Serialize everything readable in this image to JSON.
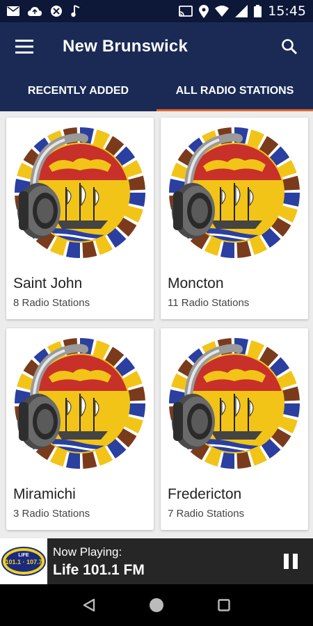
{
  "status_bar": {
    "time": "15:45",
    "icons": [
      "mail-icon",
      "cloud-upload-icon",
      "vpn-icon",
      "music-icon",
      "cast-icon",
      "location-icon",
      "wifi-icon",
      "signal-icon",
      "battery-icon"
    ]
  },
  "app_bar": {
    "title": "New Brunswick",
    "menu_icon": "menu-icon",
    "search_icon": "search-icon"
  },
  "tabs": [
    {
      "label": "RECENTLY ADDED",
      "active": false
    },
    {
      "label": "ALL RADIO STATIONS",
      "active": true
    }
  ],
  "cities": [
    {
      "name": "Saint John",
      "count": "8 Radio Stations"
    },
    {
      "name": "Moncton",
      "count": "11 Radio Stations"
    },
    {
      "name": "Miramichi",
      "count": "3 Radio Stations"
    },
    {
      "name": "Fredericton",
      "count": "7 Radio Stations"
    }
  ],
  "player": {
    "label": "Now Playing:",
    "station": "Life 101.1 FM",
    "logo_text": "101.1 · 107.7",
    "logo_top": "LIFE"
  },
  "colors": {
    "status_bar": "#0d1738",
    "app_bar": "#1a2a55",
    "tab_indicator": "#e0642c",
    "player_bg": "#262626"
  }
}
